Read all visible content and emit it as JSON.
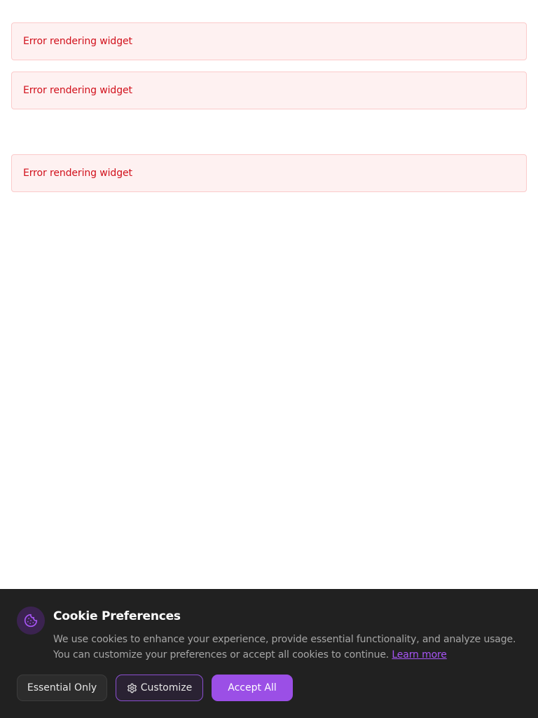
{
  "errors": [
    {
      "text": "Error rendering widget"
    },
    {
      "text": "Error rendering widget"
    },
    {
      "text": "Error rendering widget"
    }
  ],
  "cookie_banner": {
    "icon": "cookie-icon",
    "title": "Cookie Preferences",
    "description": "We use cookies to enhance your experience, provide essential functionality, and analyze usage. You can customize your preferences or accept all cookies to continue.",
    "learn_more": "Learn more",
    "buttons": {
      "essential": "Essential Only",
      "customize": "Customize",
      "accept": "Accept All"
    }
  },
  "colors": {
    "error_text": "#d1101b",
    "error_bg": "#fef1f1",
    "banner_bg": "#212121",
    "accent": "#9b4fe6",
    "link": "#a855f7"
  }
}
